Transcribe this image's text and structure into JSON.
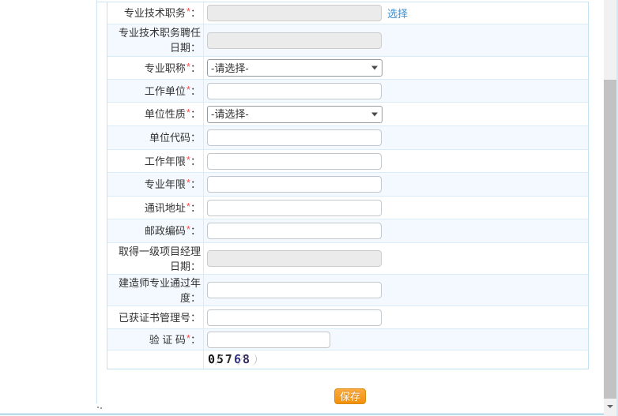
{
  "marks": {
    "required": "*",
    "colon": "："
  },
  "form": {
    "rows": [
      {
        "label": "专业技术职务",
        "required": true,
        "type": "disabled_with_link",
        "value": "",
        "link": "选择"
      },
      {
        "label": "专业技术职务聘任日期",
        "required": false,
        "type": "disabled",
        "value": ""
      },
      {
        "label": "专业职称",
        "required": true,
        "type": "select",
        "value": "-请选择-"
      },
      {
        "label": "工作单位",
        "required": true,
        "type": "input",
        "value": ""
      },
      {
        "label": "单位性质",
        "required": true,
        "type": "select",
        "value": "-请选择-"
      },
      {
        "label": "单位代码",
        "required": false,
        "type": "input",
        "value": ""
      },
      {
        "label": "工作年限",
        "required": true,
        "type": "input",
        "value": ""
      },
      {
        "label": "专业年限",
        "required": true,
        "type": "input",
        "value": ""
      },
      {
        "label": "通讯地址",
        "required": true,
        "type": "input",
        "value": ""
      },
      {
        "label": "邮政编码",
        "required": true,
        "type": "input",
        "value": ""
      },
      {
        "label": "取得一级项目经理日期",
        "required": false,
        "type": "disabled",
        "value": ""
      },
      {
        "label": "建造师专业通过年度",
        "required": false,
        "type": "input",
        "value": ""
      },
      {
        "label": "已获证书管理号",
        "required": false,
        "type": "input",
        "value": ""
      },
      {
        "label": "验 证 码",
        "required": true,
        "type": "input_short",
        "value": ""
      },
      {
        "label": "",
        "required": false,
        "type": "captcha"
      }
    ]
  },
  "links": {
    "choose": "选择"
  },
  "captcha": {
    "code": "05768",
    "digits": [
      "0",
      "5",
      "7",
      "6",
      "8"
    ]
  },
  "buttons": {
    "save": "保存"
  },
  "colors": {
    "accent_orange": "#f89406",
    "link_blue": "#3a8fd2",
    "required_red": "#ff4a4a",
    "row_tint": "#f3f9fe",
    "border_blue": "#cde4f3",
    "disabled_gray": "#ebebeb"
  }
}
